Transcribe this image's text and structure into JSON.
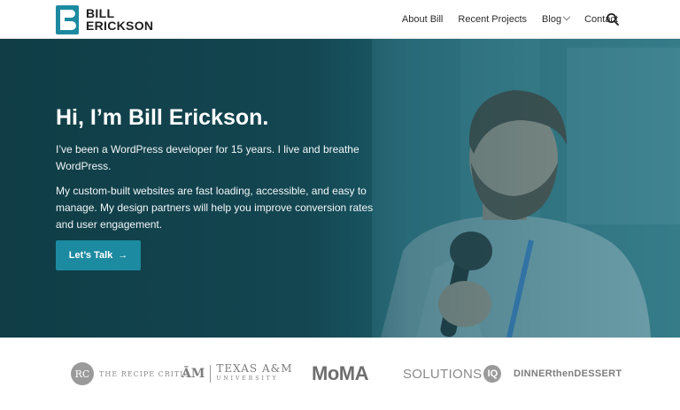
{
  "brand": {
    "line1": "BILL",
    "line2": "ERICKSON"
  },
  "nav": {
    "items": [
      {
        "label": "About Bill"
      },
      {
        "label": "Recent Projects"
      },
      {
        "label": "Blog"
      },
      {
        "label": "Contact"
      }
    ]
  },
  "hero": {
    "title": "Hi, I’m Bill Erickson.",
    "paragraph1": "I’ve been a WordPress developer for 15 years. I live and breathe WordPress.",
    "paragraph2": "My custom-built websites are fast loading, accessible, and easy to manage. My design partners will help you improve conversion rates and user engagement.",
    "cta_label": "Let’s Talk",
    "cta_arrow": "→"
  },
  "clients": {
    "recipe_critic": {
      "mark": "RC",
      "name": "THE RECIPE CRITIC"
    },
    "tamu": {
      "mark": "ĀM",
      "name": "TEXAS A&M",
      "sub": "UNIVERSITY"
    },
    "moma": {
      "name": "MoMA"
    },
    "solutions_iq": {
      "name": "SOLUTIONS",
      "badge": "IQ"
    },
    "dinner_dessert": {
      "part1": "DINNER",
      "then": "then",
      "part2": "DESSERT"
    }
  },
  "colors": {
    "accent": "#1c8aa0",
    "hero_overlay": "#134651"
  }
}
